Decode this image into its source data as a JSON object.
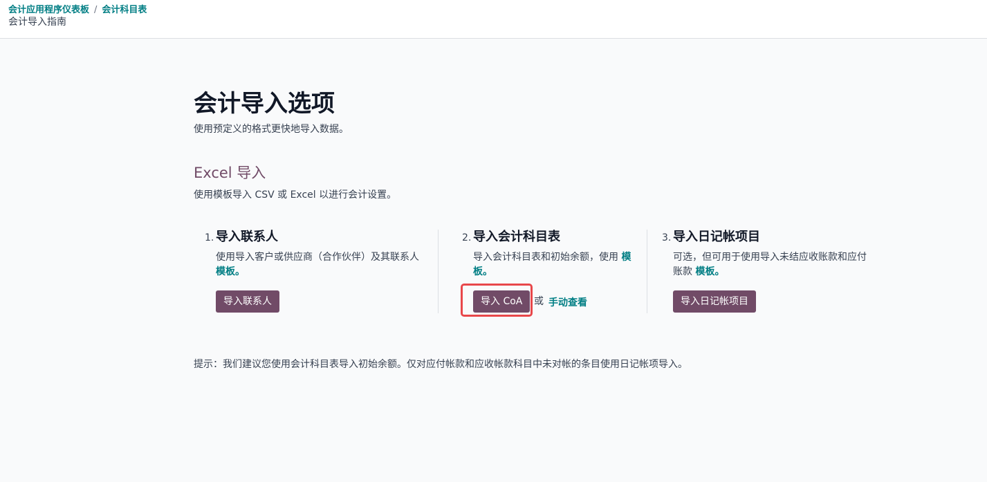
{
  "breadcrumb": {
    "items": [
      "会计应用程序仪表板",
      "会计科目表"
    ],
    "separator": "/",
    "current": "会计导入指南"
  },
  "page": {
    "title": "会计导入选项",
    "subtitle": "使用预定义的格式更快地导入数据。"
  },
  "section": {
    "title": "Excel 导入",
    "description": "使用模板导入 CSV 或 Excel 以进行会计设置。"
  },
  "steps": [
    {
      "number": "1.",
      "title": "导入联系人",
      "description": "使用导入客户或供应商（合作伙伴）及其联系人",
      "link": "模板。",
      "button": "导入联系人"
    },
    {
      "number": "2.",
      "title": "导入会计科目表",
      "description": "导入会计科目表和初始余额，使用",
      "link": "模板。",
      "button": "导入 CoA",
      "or": "或",
      "secondary_link": "手动查看"
    },
    {
      "number": "3.",
      "title": "导入日记帐项目",
      "description": "可选，但可用于使用导入未结应收账款和应付账款",
      "link": "模板。",
      "button": "导入日记帐项目"
    }
  ],
  "tip": "提示：我们建议您使用会计科目表导入初始余额。仅对应付帐款和应收帐款科目中未对帐的条目使用日记帐项导入。",
  "colors": {
    "brand": "#714b67",
    "link": "#017e84",
    "highlight": "#e8474a"
  }
}
